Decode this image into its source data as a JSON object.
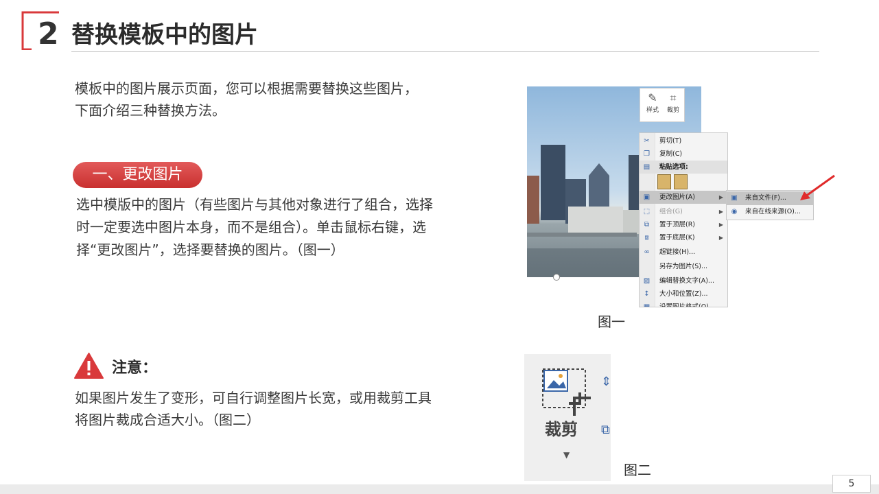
{
  "header": {
    "section_number": "2",
    "title": "替换模板中的图片",
    "accent_color": "#d9393b"
  },
  "intro": {
    "line1": "模板中的图片展示页面，您可以根据需要替换这些图片，",
    "line2": "下面介绍三种替换方法。"
  },
  "method1": {
    "label": "一、更改图片",
    "line1": "选中模版中的图片（有些图片与其他对象进行了组合，选择",
    "line2": "时一定要选中图片本身，而不是组合）。单击鼠标右键，选",
    "line3": "择“更改图片”，选择要替换的图片。（图一）"
  },
  "note": {
    "title": "注意：",
    "line1": "如果图片发生了变形，可自行调整图片长宽，或用裁剪工具",
    "line2": "将图片裁成合适大小。（图二）",
    "icon": "warning-icon"
  },
  "figure1": {
    "caption": "图一",
    "mini_toolbar": {
      "style_label": "样式",
      "crop_label": "裁剪"
    },
    "context_menu": [
      {
        "label": "剪切(T)",
        "icon": "scissors-icon"
      },
      {
        "label": "复制(C)",
        "icon": "copy-icon"
      },
      {
        "label": "粘贴选项:",
        "icon": "paste-icon"
      },
      {
        "label": "更改图片(A)",
        "icon": "change-picture-icon",
        "submenu": true,
        "highlighted": true
      },
      {
        "label": "组合(G)",
        "icon": "group-icon",
        "submenu": true,
        "disabled": true
      },
      {
        "label": "置于顶层(R)",
        "icon": "bring-front-icon",
        "submenu": true
      },
      {
        "label": "置于底层(K)",
        "icon": "send-back-icon",
        "submenu": true
      },
      {
        "label": "超链接(H)...",
        "icon": "hyperlink-icon"
      },
      {
        "label": "另存为图片(S)...",
        "icon": ""
      },
      {
        "label": "编辑替换文字(A)...",
        "icon": "alt-text-icon"
      },
      {
        "label": "大小和位置(Z)...",
        "icon": "size-position-icon"
      },
      {
        "label": "设置图片格式(O)...",
        "icon": "format-picture-icon"
      }
    ],
    "submenu": [
      {
        "label": "来自文件(F)...",
        "icon": "from-file-icon",
        "highlighted": true
      },
      {
        "label": "来自在线来源(O)...",
        "icon": "online-source-icon"
      }
    ]
  },
  "figure2": {
    "caption": "图二",
    "crop_label": "裁剪"
  },
  "footer": {
    "page_number": "5"
  }
}
